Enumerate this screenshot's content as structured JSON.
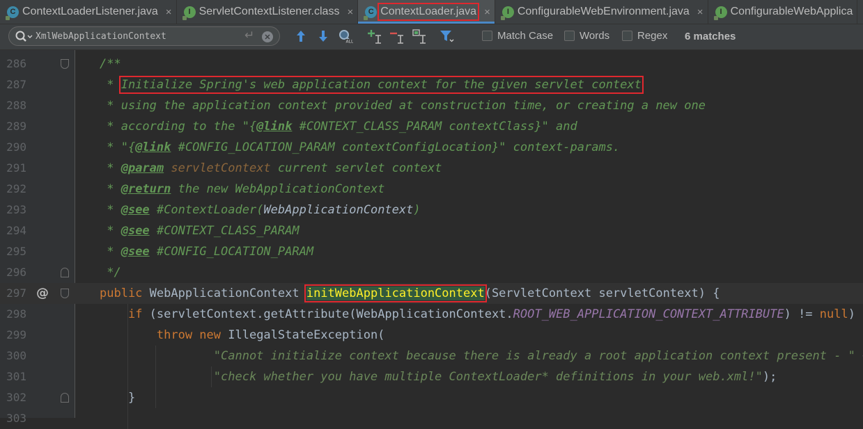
{
  "tabs": [
    {
      "label": "ContextLoaderListener.java",
      "icon": "class-icon",
      "active": false
    },
    {
      "label": "ServletContextListener.class",
      "icon": "interface-icon",
      "active": false
    },
    {
      "label": "ContextLoader.java",
      "icon": "class-icon",
      "active": true
    },
    {
      "label": "ConfigurableWebEnvironment.java",
      "icon": "interface-icon",
      "active": false
    },
    {
      "label": "ConfigurableWebApplica",
      "icon": "interface-icon",
      "active": false
    }
  ],
  "search": {
    "value": "XmlWebApplicationContext",
    "options": {
      "match_case": "Match Case",
      "words": "Words",
      "regex": "Regex"
    },
    "matches": "6 matches"
  },
  "gutter": {
    "override_marker": "@"
  },
  "code": {
    "lines": [
      {
        "num": "286",
        "parts": [
          {
            "t": "/**",
            "c": "doc"
          }
        ]
      },
      {
        "num": "287",
        "parts": [
          {
            "t": " * ",
            "c": "doc"
          },
          {
            "t": "Initialize Spring's web application context for the given servlet context",
            "c": "doc",
            "box": true
          }
        ]
      },
      {
        "num": "288",
        "parts": [
          {
            "t": " * using the application context provided at construction time, or creating a new one",
            "c": "doc"
          }
        ]
      },
      {
        "num": "289",
        "parts": [
          {
            "t": " * according to the \"{",
            "c": "doc"
          },
          {
            "t": "@link",
            "c": "tag"
          },
          {
            "t": " #CONTEXT_CLASS_PARAM contextClass}\" and",
            "c": "doc"
          }
        ]
      },
      {
        "num": "290",
        "parts": [
          {
            "t": " * \"{",
            "c": "doc"
          },
          {
            "t": "@link",
            "c": "tag"
          },
          {
            "t": " #CONFIG_LOCATION_PARAM contextConfigLocation}\" context-params.",
            "c": "doc"
          }
        ]
      },
      {
        "num": "291",
        "parts": [
          {
            "t": " * ",
            "c": "doc"
          },
          {
            "t": "@param",
            "c": "tag"
          },
          {
            "t": " servletContext",
            "c": "tagval"
          },
          {
            "t": " current servlet context",
            "c": "doc"
          }
        ]
      },
      {
        "num": "292",
        "parts": [
          {
            "t": " * ",
            "c": "doc"
          },
          {
            "t": "@return",
            "c": "tag"
          },
          {
            "t": " the new WebApplicationContext",
            "c": "doc"
          }
        ]
      },
      {
        "num": "293",
        "parts": [
          {
            "t": " * ",
            "c": "doc"
          },
          {
            "t": "@see",
            "c": "tag"
          },
          {
            "t": " #ContextLoader(",
            "c": "doc"
          },
          {
            "t": "WebApplicationContext",
            "c": "docref"
          },
          {
            "t": ")",
            "c": "doc"
          }
        ]
      },
      {
        "num": "294",
        "parts": [
          {
            "t": " * ",
            "c": "doc"
          },
          {
            "t": "@see",
            "c": "tag"
          },
          {
            "t": " #CONTEXT_CLASS_PARAM",
            "c": "doc"
          }
        ]
      },
      {
        "num": "295",
        "parts": [
          {
            "t": " * ",
            "c": "doc"
          },
          {
            "t": "@see",
            "c": "tag"
          },
          {
            "t": " #CONFIG_LOCATION_PARAM",
            "c": "doc"
          }
        ]
      },
      {
        "num": "296",
        "parts": [
          {
            "t": " */",
            "c": "doc"
          }
        ]
      },
      {
        "num": "297",
        "parts": [
          {
            "t": "public",
            "c": "kw"
          },
          {
            "t": " WebApplicationContext ",
            "c": "plain"
          },
          {
            "t": "initWebApplicationContext",
            "c": "method",
            "box": true
          },
          {
            "t": "(ServletContext servletContext) {",
            "c": "plain"
          }
        ]
      },
      {
        "num": "298",
        "parts": [
          {
            "t": "    ",
            "c": "plain"
          },
          {
            "t": "if",
            "c": "kw"
          },
          {
            "t": " (servletContext.getAttribute(WebApplicationContext.",
            "c": "plain"
          },
          {
            "t": "ROOT_WEB_APPLICATION_CONTEXT_ATTRIBUTE",
            "c": "cst"
          },
          {
            "t": ") != ",
            "c": "plain"
          },
          {
            "t": "null",
            "c": "kw"
          },
          {
            "t": ") {",
            "c": "plain"
          }
        ]
      },
      {
        "num": "299",
        "parts": [
          {
            "t": "        ",
            "c": "plain"
          },
          {
            "t": "throw new",
            "c": "kw"
          },
          {
            "t": " IllegalStateException(",
            "c": "plain"
          }
        ]
      },
      {
        "num": "300",
        "parts": [
          {
            "t": "                ",
            "c": "plain"
          },
          {
            "t": "\"Cannot initialize context because there is already a root application context present - \"",
            "c": "str"
          },
          {
            "t": " +",
            "c": "plain"
          }
        ]
      },
      {
        "num": "301",
        "parts": [
          {
            "t": "                ",
            "c": "plain"
          },
          {
            "t": "\"check whether you have multiple ContextLoader* definitions in your web.xml!\"",
            "c": "str"
          },
          {
            "t": ");",
            "c": "plain"
          }
        ]
      },
      {
        "num": "302",
        "parts": [
          {
            "t": "    }",
            "c": "plain"
          }
        ]
      },
      {
        "num": "303",
        "parts": []
      }
    ]
  }
}
